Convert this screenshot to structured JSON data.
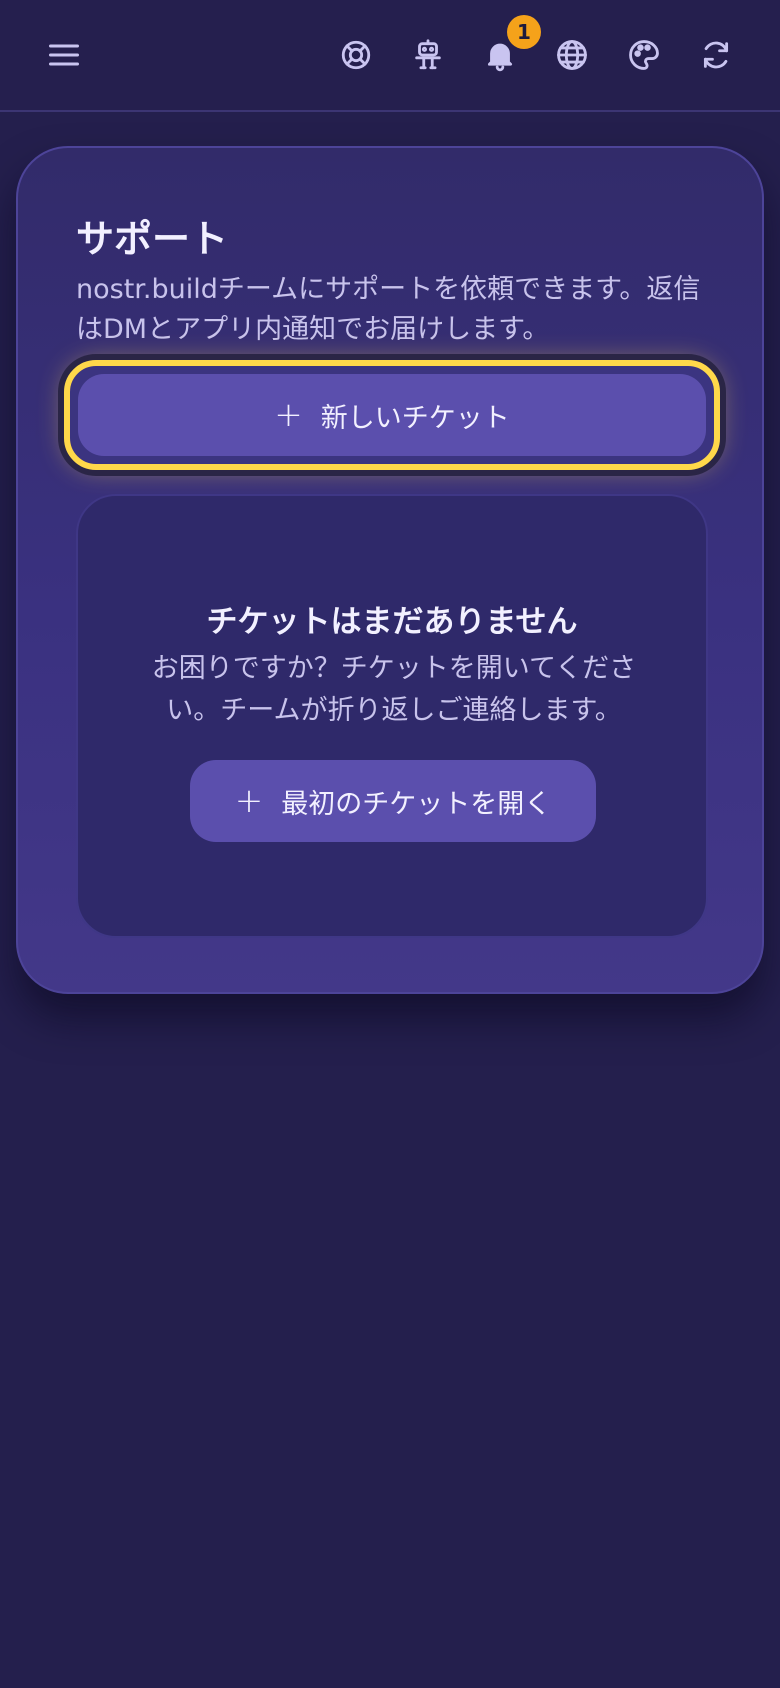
{
  "topbar": {
    "icons": [
      "menu-icon",
      "support-icon",
      "robot-icon",
      "bell-icon",
      "globe-icon",
      "palette-icon",
      "refresh-icon"
    ],
    "notification_count": "1"
  },
  "support": {
    "title": "サポート",
    "description": "nostr.buildチームにサポートを依頼できます。返信はDMとアプリ内通知でお届けします。",
    "new_ticket_label": "新しいチケット",
    "empty_title": "チケットはまだありません",
    "empty_description": "お困りですか？チケットを開いてください。チームが折り返しご連絡します。",
    "first_ticket_label": "最初のチケットを開く"
  },
  "colors": {
    "background": "#241f4d",
    "card": "#3a3180",
    "button": "#5b4fad",
    "focus_ring": "#ffd84a",
    "badge": "#f5a21a"
  }
}
